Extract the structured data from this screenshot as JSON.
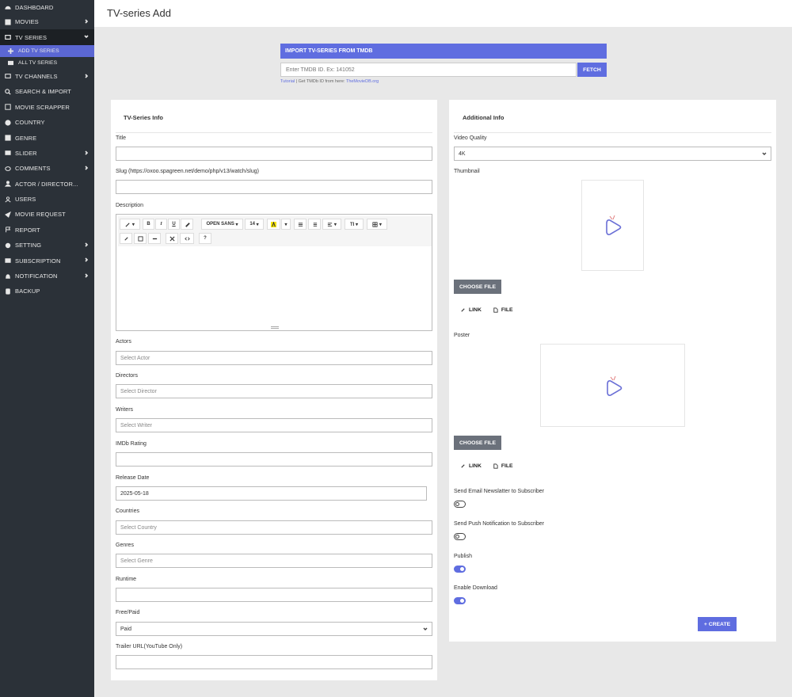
{
  "sidebar": {
    "items": [
      {
        "label": "DASHBOARD",
        "icon": "dashboard-icon"
      },
      {
        "label": "MOVIES",
        "icon": "film-icon"
      },
      {
        "label": "TV SERIES",
        "icon": "tv-series-icon"
      },
      {
        "label": "TV CHANNELS",
        "icon": "tv-icon"
      },
      {
        "label": "SEARCH & IMPORT",
        "icon": "search-icon"
      },
      {
        "label": "MOVIE SCRAPPER",
        "icon": "scrapper-icon"
      },
      {
        "label": "COUNTRY",
        "icon": "globe-icon"
      },
      {
        "label": "GENRE",
        "icon": "genre-icon"
      },
      {
        "label": "SLIDER",
        "icon": "slider-icon"
      },
      {
        "label": "COMMENTS",
        "icon": "comment-icon"
      },
      {
        "label": "ACTOR / DIRECTOR...",
        "icon": "user-icon"
      },
      {
        "label": "USERS",
        "icon": "users-icon"
      },
      {
        "label": "MOVIE REQUEST",
        "icon": "send-icon"
      },
      {
        "label": "REPORT",
        "icon": "flag-icon"
      },
      {
        "label": "SETTING",
        "icon": "gear-icon"
      },
      {
        "label": "SUBSCRIPTION",
        "icon": "subscription-icon"
      },
      {
        "label": "NOTIFICATION",
        "icon": "bell-icon"
      },
      {
        "label": "BACKUP",
        "icon": "database-icon"
      }
    ],
    "sub_items": [
      {
        "label": "ADD TV SERIES",
        "icon": "plus-icon"
      },
      {
        "label": "ALL TV SERIES",
        "icon": "list-icon"
      }
    ]
  },
  "page_title": "TV-series Add",
  "import": {
    "title": "IMPORT TV-SERIES FROM TMDB",
    "placeholder": "Enter TMDB ID. Ex: 141052",
    "fetch_label": "FETCH",
    "tutorial_link": "Tutorial",
    "note_text": " | Get TMDb ID from here: ",
    "site_link": "TheMovieDB.org"
  },
  "left": {
    "title": "TV-Series Info",
    "title_label": "Title",
    "slug_label": "Slug (https://oxoo.spagreen.net/demo/php/v13/watch/slug)",
    "description_label": "Description",
    "editor": {
      "font_name": "OPEN SANS",
      "font_size": "14",
      "bold": "B",
      "italic": "I",
      "underline": "U",
      "help": "?"
    },
    "actors_label": "Actors",
    "actors_placeholder": "Select Actor",
    "directors_label": "Directors",
    "directors_placeholder": "Select Director",
    "writers_label": "Writers",
    "writers_placeholder": "Select Writer",
    "imdb_label": "IMDb Rating",
    "release_label": "Release Date",
    "release_value": "2025-05-18",
    "countries_label": "Countries",
    "countries_placeholder": "Select Country",
    "genres_label": "Genres",
    "genres_placeholder": "Select Genre",
    "runtime_label": "Runtime",
    "free_paid_label": "Free/Paid",
    "free_paid_value": "Paid",
    "trailer_label": "Trailer URL(YouTube Only)"
  },
  "right": {
    "title": "Additional Info",
    "video_quality_label": "Video Quality",
    "video_quality_value": "4K",
    "thumbnail_label": "Thumbnail",
    "choose_file": "CHOOSE FILE",
    "link_tab": "LINK",
    "file_tab": "FILE",
    "poster_label": "Poster",
    "newsletter_label": "Send Email Newslatter to Subscriber",
    "push_label": "Send Push Notification to Subscriber",
    "publish_label": "Publish",
    "download_label": "Enable Download",
    "create_label": "+ CREATE"
  },
  "colors": {
    "accent": "#5f6de0",
    "sidebar_bg": "#2b3138",
    "active_item": "#5b67d3"
  }
}
